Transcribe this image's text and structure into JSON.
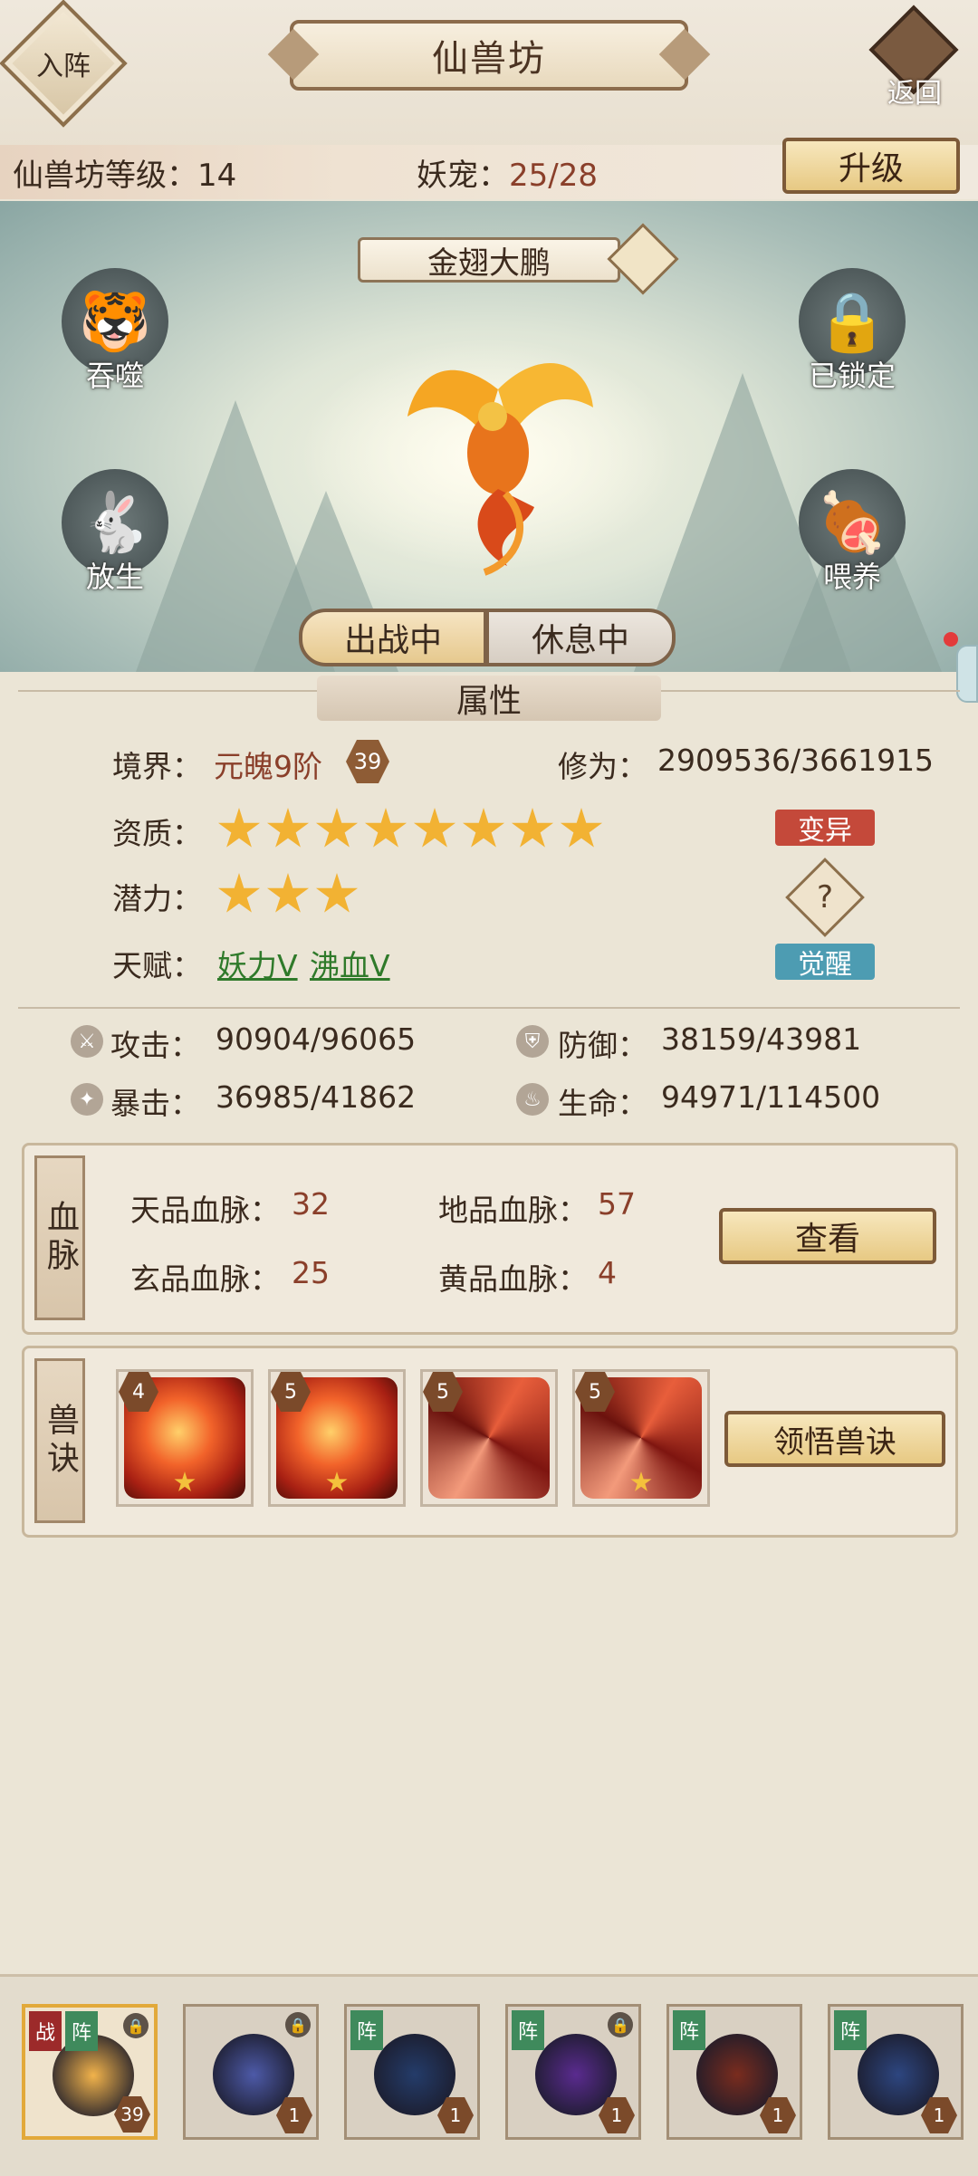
{
  "header": {
    "left_button": "入阵",
    "title": "仙兽坊",
    "back_button": "返回",
    "level_label": "仙兽坊等级：",
    "level_value": "14",
    "pets_label": "妖宠：",
    "pets_value": "25/28",
    "upgrade_button": "升级"
  },
  "pet": {
    "name": "金翅大鹏",
    "actions_left": [
      {
        "label": "吞噬",
        "icon": "tiger-head-icon"
      },
      {
        "label": "放生",
        "icon": "rabbit-icon"
      }
    ],
    "actions_right": [
      {
        "label": "已锁定",
        "icon": "locked-chain-icon"
      },
      {
        "label": "喂养",
        "icon": "meat-icon"
      }
    ],
    "tabs": {
      "active": "出战中",
      "inactive": "休息中"
    }
  },
  "attributes": {
    "section_title": "属性",
    "realm_label": "境界：",
    "realm_value": "元魄9阶",
    "realm_badge": "39",
    "cultivation_label": "修为：",
    "cultivation_value": "2909536/3661915",
    "aptitude_label": "资质：",
    "aptitude_stars": 8,
    "mutate_button": "变异",
    "potential_label": "潜力：",
    "potential_stars": 3,
    "help_button": "?",
    "talent_label": "天赋：",
    "talent_1": "妖力V",
    "talent_2": "沸血V",
    "awaken_button": "觉醒"
  },
  "stats": {
    "attack_label": "攻击：",
    "attack_value": "90904/96065",
    "defense_label": "防御：",
    "defense_value": "38159/43981",
    "crit_label": "暴击：",
    "crit_value": "36985/41862",
    "hp_label": "生命：",
    "hp_value": "94971/114500"
  },
  "bloodline": {
    "tag": "血脉",
    "tian_label": "天品血脉：",
    "tian_value": "32",
    "di_label": "地品血脉：",
    "di_value": "57",
    "xuan_label": "玄品血脉：",
    "xuan_value": "25",
    "huang_label": "黄品血脉：",
    "huang_value": "4",
    "view_button": "查看"
  },
  "skills": {
    "tag": "兽诀",
    "items": [
      {
        "level": "4",
        "kind": "fire"
      },
      {
        "level": "5",
        "kind": "fire"
      },
      {
        "level": "5",
        "kind": "swirl"
      },
      {
        "level": "5",
        "kind": "swirl"
      }
    ],
    "learn_button": "领悟兽诀"
  },
  "roster": {
    "tag_zhan": "战",
    "tag_zhen": "阵",
    "cards": [
      {
        "level": "39",
        "color": "#f2b34b"
      },
      {
        "level": "1",
        "color": "#4d5aa8"
      },
      {
        "level": "1",
        "color": "#243c6a"
      },
      {
        "level": "1",
        "color": "#5a2b8f"
      },
      {
        "level": "1",
        "color": "#7a2c1e"
      },
      {
        "level": "1",
        "color": "#2d4680"
      }
    ]
  },
  "colors": {
    "accent_red": "#8a3f2a",
    "talent_green": "#2f7a2a",
    "gold": "#e7c983"
  }
}
